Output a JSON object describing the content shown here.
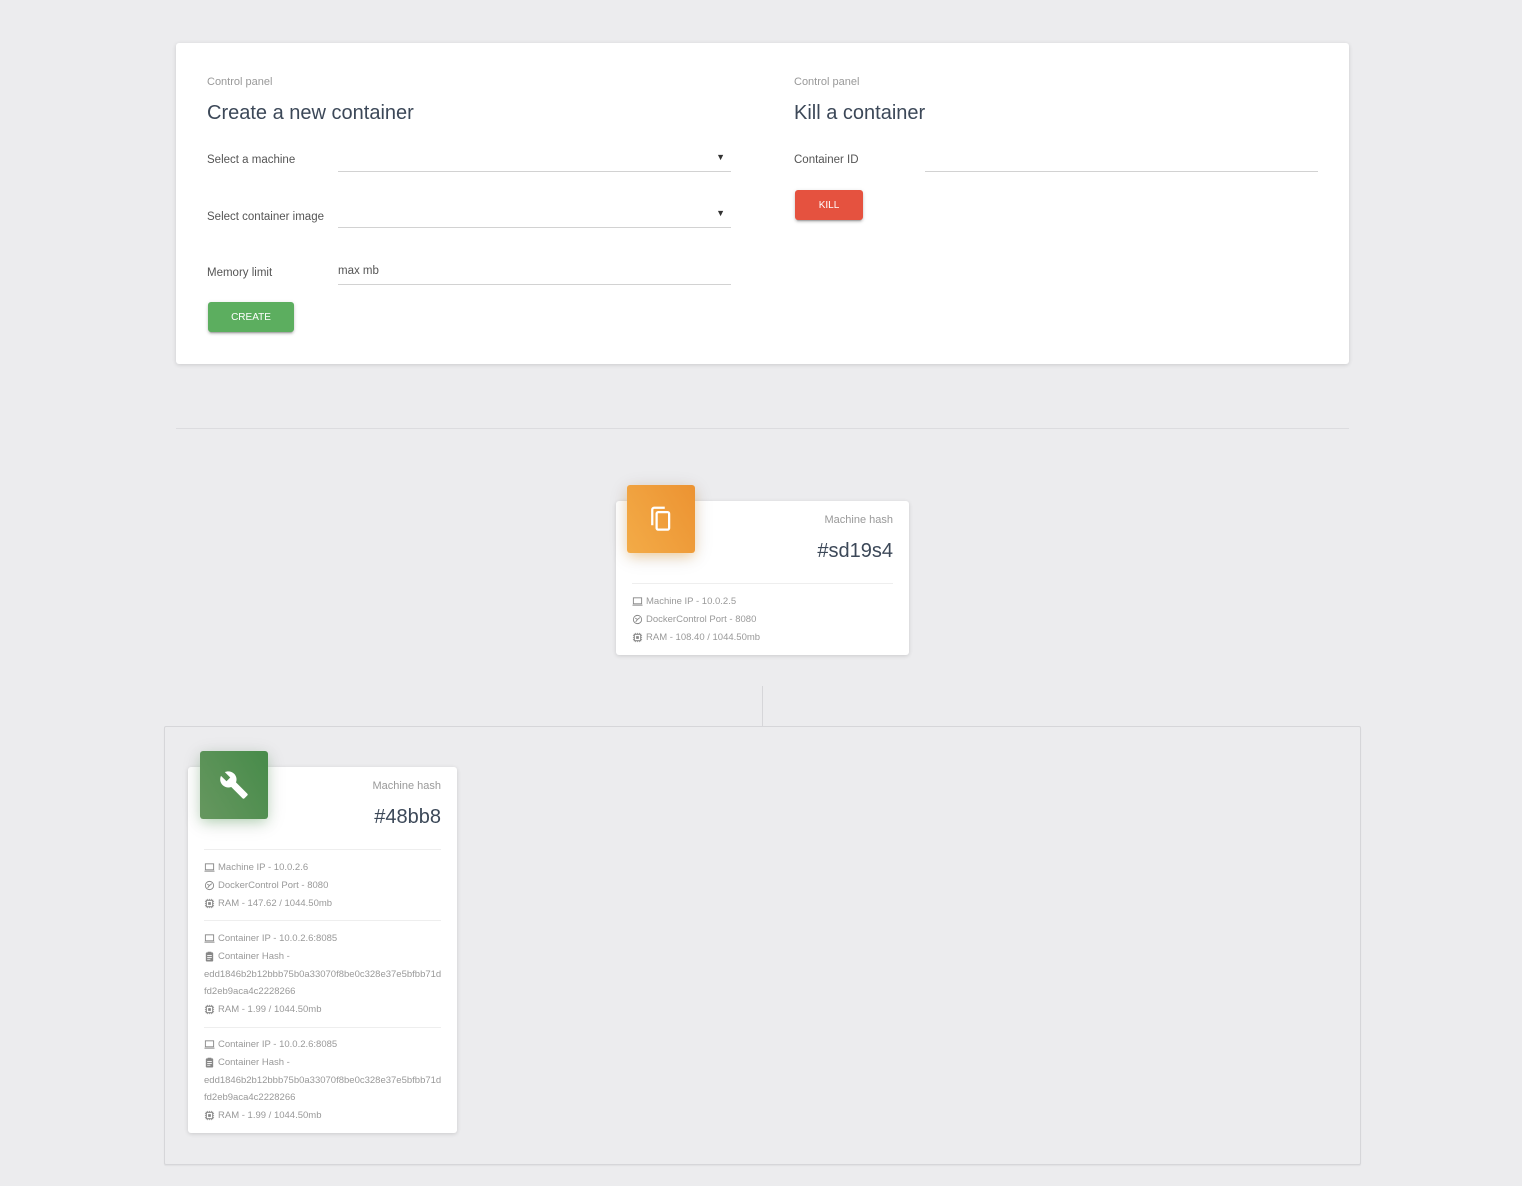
{
  "control_panel": {
    "create": {
      "subtitle": "Control panel",
      "title": "Create a new container",
      "machine_label": "Select a machine",
      "machine_value": "",
      "image_label": "Select container image",
      "image_value": "",
      "memory_label": "Memory limit",
      "memory_placeholder": "max mb",
      "memory_value": "",
      "button_label": "CREATE",
      "button_color": "#5cae5f"
    },
    "kill": {
      "subtitle": "Control panel",
      "title": "Kill a container",
      "container_id_label": "Container ID",
      "container_id_value": "",
      "button_label": "KILL",
      "button_color": "#e5523f"
    }
  },
  "machines": [
    {
      "icon": "copy-icon",
      "icon_color": "#ef9c3a",
      "category": "Machine hash",
      "hash": "#sd19s4",
      "stats": {
        "ip": "Machine IP - 10.0.2.5",
        "port": "DockerControl Port - 8080",
        "ram": "RAM - 108.40 / 1044.50mb"
      }
    },
    {
      "icon": "wrench-icon",
      "icon_color": "#559158",
      "category": "Machine hash",
      "hash": "#48bb8",
      "stats": {
        "ip": "Machine IP - 10.0.2.6",
        "port": "DockerControl Port - 8080",
        "ram": "RAM - 147.62 / 1044.50mb"
      },
      "containers": [
        {
          "ip": "Container IP - 10.0.2.6:8085",
          "hash_label": "Container Hash -",
          "hash_line1": "edd1846b2b12bbb75b0a33070f8be0c328e37e5bfbb71d",
          "hash_line2": "fd2eb9aca4c2228266",
          "ram": "RAM - 1.99 / 1044.50mb"
        },
        {
          "ip": "Container IP - 10.0.2.6:8085",
          "hash_label": "Container Hash -",
          "hash_line1": "edd1846b2b12bbb75b0a33070f8be0c328e37e5bfbb71d",
          "hash_line2": "fd2eb9aca4c2228266",
          "ram": "RAM - 1.99 / 1044.50mb"
        }
      ]
    }
  ]
}
